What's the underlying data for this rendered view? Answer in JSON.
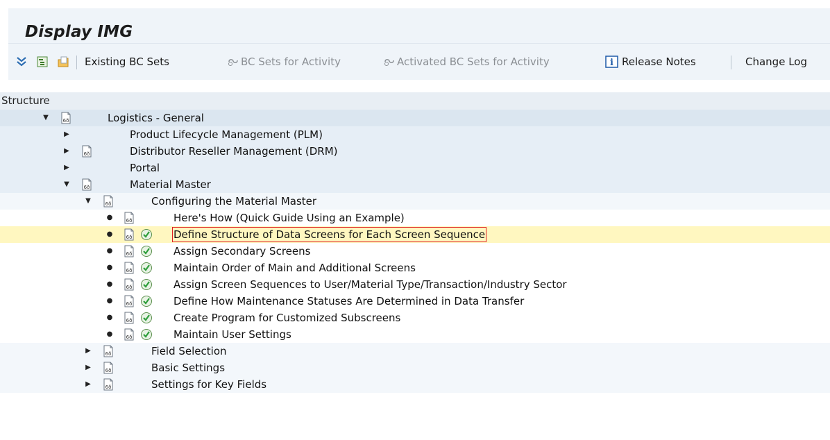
{
  "window": {
    "title": "Display IMG"
  },
  "toolbar": {
    "buttons": [
      {
        "label": "Existing BC Sets",
        "enabled": true
      },
      {
        "label": "BC Sets for Activity",
        "enabled": false
      },
      {
        "label": "Activated BC Sets for Activity",
        "enabled": false
      },
      {
        "label": "Release Notes",
        "enabled": true
      },
      {
        "label": "Change Log",
        "enabled": true
      }
    ]
  },
  "tree": {
    "header": "Structure",
    "rows": [
      {
        "label": "Logistics - General",
        "level": 0,
        "expanded": true
      },
      {
        "label": "Product Lifecycle Management (PLM)",
        "level": 1,
        "expanded": false
      },
      {
        "label": "Distributor Reseller Management (DRM)",
        "level": 1,
        "expanded": false
      },
      {
        "label": "Portal",
        "level": 1,
        "expanded": false
      },
      {
        "label": "Material Master",
        "level": 1,
        "expanded": true
      },
      {
        "label": "Configuring the Material Master",
        "level": 2,
        "expanded": true
      },
      {
        "label": "Here's How (Quick Guide Using an Example)",
        "level": 3
      },
      {
        "label": "Define Structure of Data Screens for Each Screen Sequence",
        "level": 3,
        "selected": true
      },
      {
        "label": "Assign Secondary Screens",
        "level": 3
      },
      {
        "label": "Maintain Order of Main and Additional Screens",
        "level": 3
      },
      {
        "label": "Assign Screen Sequences to User/Material Type/Transaction/Industry Sector",
        "level": 3
      },
      {
        "label": "Define How Maintenance Statuses Are Determined in Data Transfer",
        "level": 3
      },
      {
        "label": "Create Program for Customized Subscreens",
        "level": 3
      },
      {
        "label": "Maintain User Settings",
        "level": 3
      },
      {
        "label": "Field Selection",
        "level": 2,
        "expanded": false
      },
      {
        "label": "Basic Settings",
        "level": 2,
        "expanded": false
      },
      {
        "label": "Settings for Key Fields",
        "level": 2,
        "expanded": false
      }
    ]
  },
  "colors": {
    "selected_row": "#fff7c0",
    "focus_outline": "#e02020",
    "execute_icon": "#2e9e3b"
  }
}
